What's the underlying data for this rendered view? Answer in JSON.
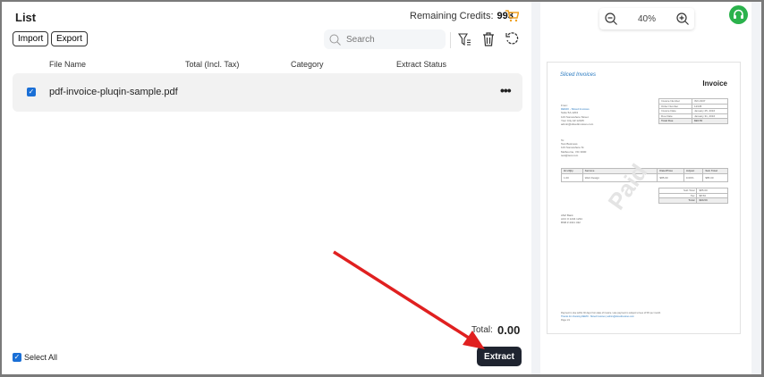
{
  "list": {
    "title": "List",
    "credits_label": "Remaining Credits:",
    "credits_value": "993",
    "import_label": "Import",
    "export_label": "Export",
    "search_placeholder": "Search",
    "columns": [
      "File Name",
      "Total (Incl. Tax)",
      "Category",
      "Extract Status"
    ],
    "rows": [
      {
        "file_name": "pdf-invoice-pluqin-sample.pdf",
        "checked": true
      }
    ],
    "select_all_label": "Select All",
    "total_label": "Total:",
    "total_value": "0.00",
    "extract_label": "Extract"
  },
  "preview": {
    "zoom_level": "40%",
    "invoice": {
      "logo": "Sliced Invoices",
      "heading": "Invoice",
      "from_label": "From:",
      "from_lines": [
        "DEMO - Sliced Invoices",
        "Suite 5A-1204",
        "123 Somewhere Street",
        "Your City AZ 12345",
        "admin@slicedinvoices.com"
      ],
      "meta": [
        [
          "Invoice Number",
          "INV-3337"
        ],
        [
          "Order Number",
          "12345"
        ],
        [
          "Invoice Date",
          "January 25, 2016"
        ],
        [
          "Due Date",
          "January 31, 2016"
        ],
        [
          "Total Due",
          "$93.50"
        ]
      ],
      "to_label": "To:",
      "to_lines": [
        "Test Business",
        "123 Somewhere St",
        "Melbourne, VIC 3000",
        "test@test.com"
      ],
      "items_header": [
        "Hrs/Qty",
        "Service",
        "Rate/Price",
        "Adjust",
        "Sub Total"
      ],
      "items": [
        [
          "1.00",
          "Web Design",
          "$85.00",
          "0.00%",
          "$85.00"
        ]
      ],
      "totals": [
        [
          "Sub Total",
          "$85.00"
        ],
        [
          "Tax",
          "$8.50"
        ],
        [
          "Total",
          "$93.50"
        ]
      ],
      "watermark": "Paid",
      "bank_lines": [
        "ANZ Bank",
        "ACC # 1234 1234",
        "BSB # 4321 432"
      ],
      "footer_lines": [
        "Payment is due within 30 days from date of invoice. Late payment is subject to fees of 5% per month.",
        "Thanks for choosing DEMO - Sliced Invoices | admin@slicedinvoices.com",
        "Page 1/1"
      ]
    }
  },
  "colors": {
    "accent": "#1a6fd6",
    "cart": "#f0a020",
    "support": "#2bb24c",
    "extract_bg": "#1f2430",
    "arrow": "#e02020"
  }
}
